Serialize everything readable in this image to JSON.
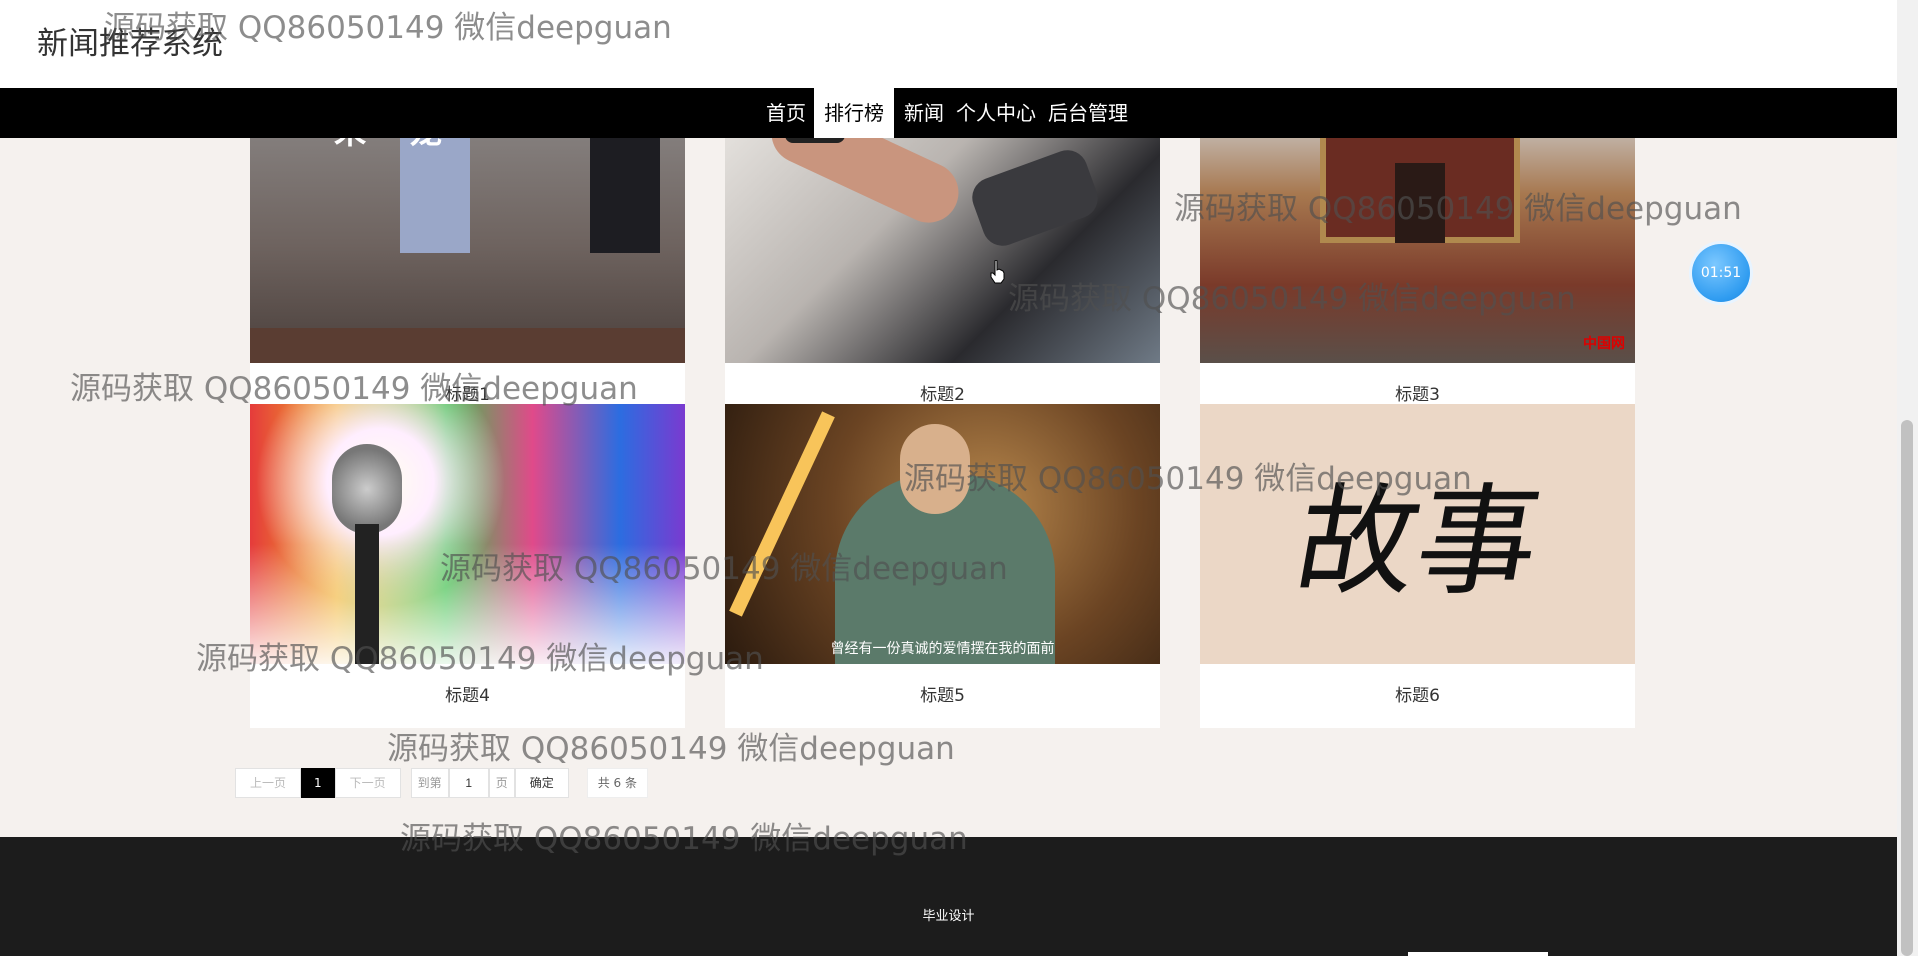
{
  "header": {
    "site_title": "新闻推荐系统"
  },
  "nav": {
    "items": [
      {
        "label": "首页"
      },
      {
        "label": "排行榜"
      },
      {
        "label": "新闻"
      },
      {
        "label": "个人中心"
      },
      {
        "label": "后台管理"
      }
    ],
    "active_index": 1
  },
  "cards": [
    {
      "title": "标题1"
    },
    {
      "title": "标题2"
    },
    {
      "title": "标题3",
      "image_logo": "中国网"
    },
    {
      "title": "标题4"
    },
    {
      "title": "标题5",
      "image_subtitle": "曾经有一份真诚的爱情摆在我的面前"
    },
    {
      "title": "标题6",
      "image_text": "故事"
    }
  ],
  "pagination": {
    "prev_label": "上一页",
    "current_page": "1",
    "next_label": "下一页",
    "goto_label": "到第",
    "goto_value": "1",
    "page_unit": "页",
    "confirm_label": "确定",
    "total_label": "共 6 条"
  },
  "timer": {
    "value": "01:51"
  },
  "footer": {
    "text": "毕业设计"
  },
  "watermark": {
    "text": "源码获取 QQ86050149 微信deepguan"
  },
  "colors": {
    "nav_bg": "#000000",
    "page_bg": "#f5f1ee",
    "footer_bg": "#1c1c1c",
    "timer_blue": "#2e9bf0"
  }
}
